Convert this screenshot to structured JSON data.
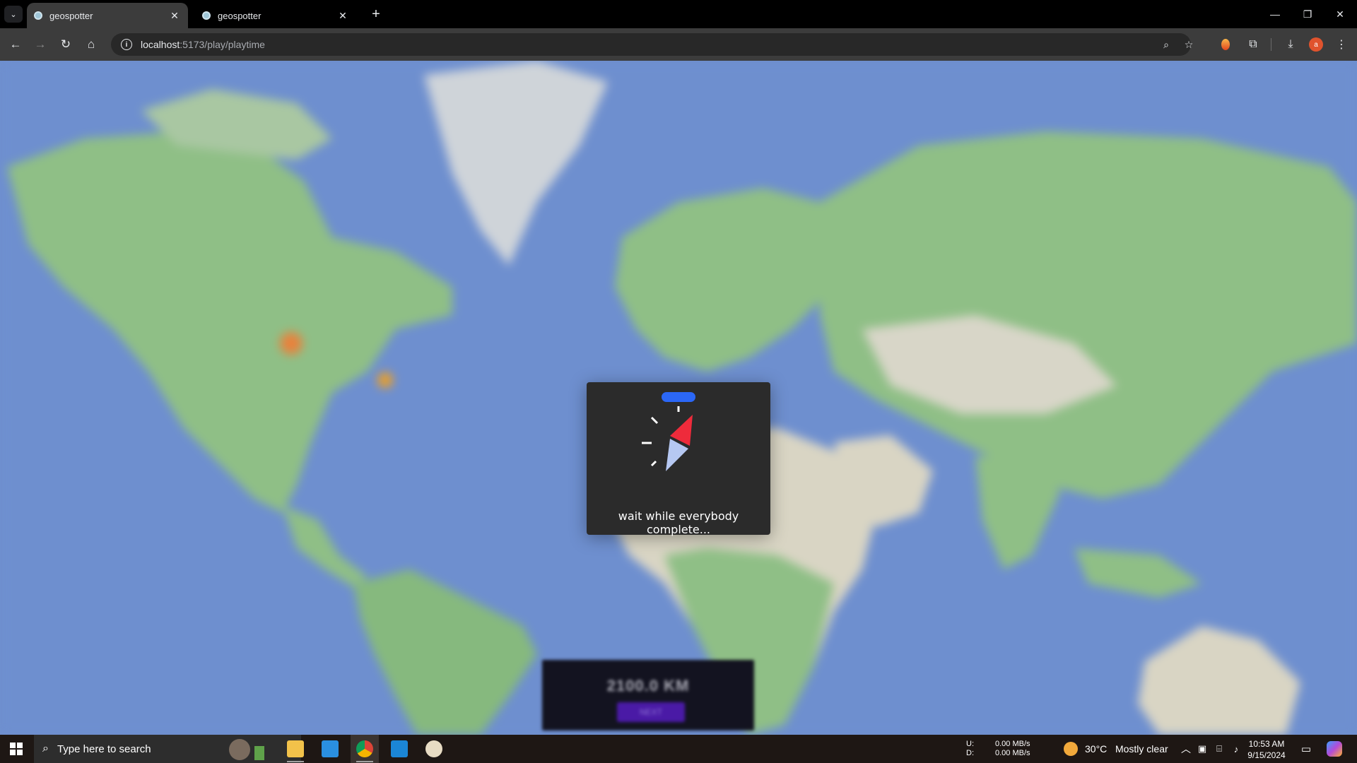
{
  "browser": {
    "tabs": [
      {
        "title": "geospotter",
        "active": true
      },
      {
        "title": "geospotter",
        "active": false
      }
    ],
    "url_host": "localhost",
    "url_path": ":5173/play/playtime",
    "profile_initial": "a"
  },
  "modal": {
    "message": "wait while everybody complete..."
  },
  "result": {
    "distance": "2100.0 KM",
    "button": "NEXT"
  },
  "taskbar": {
    "search_placeholder": "Type here to search",
    "network": {
      "up_label": "U:",
      "down_label": "D:",
      "up": "0.00 MB/s",
      "down": "0.00 MB/s"
    },
    "weather": {
      "temp": "30°C",
      "condition": "Mostly clear"
    },
    "time": "10:53 AM",
    "date": "9/15/2024"
  },
  "colors": {
    "ocean": "#6e8fcf",
    "land": "#8fbf86",
    "modal_bg": "#2b2b2b",
    "loader_blue": "#2b67f6",
    "loader_red": "#ee2b3b",
    "loader_light": "#b6c8f2"
  }
}
